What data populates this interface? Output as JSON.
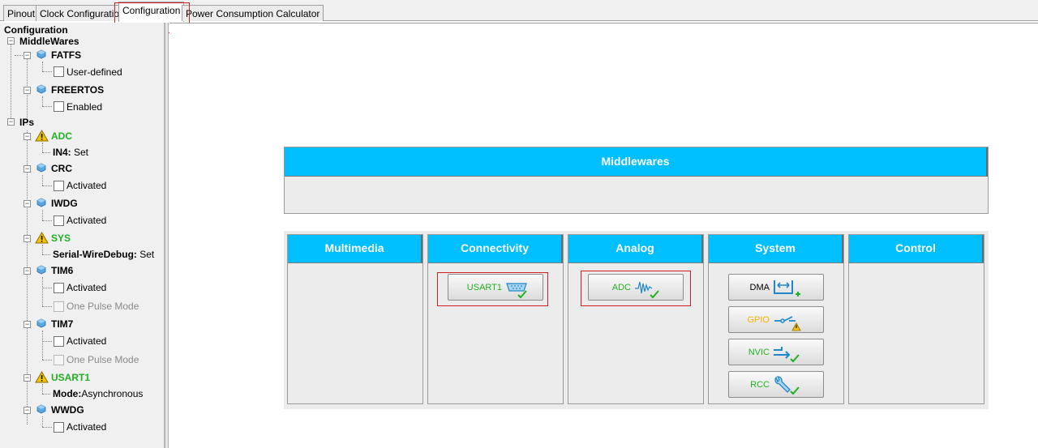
{
  "tabs": [
    {
      "label": "Pinout",
      "active": false
    },
    {
      "label": "Clock Configuration",
      "active": false
    },
    {
      "label": "Configuration",
      "active": true
    },
    {
      "label": "Power Consumption Calculator",
      "active": false
    }
  ],
  "tree": {
    "root": "Configuration",
    "middlewares": {
      "label": "MiddleWares",
      "items": [
        {
          "name": "FATFS",
          "option": "User-defined"
        },
        {
          "name": "FREERTOS",
          "option": "Enabled"
        }
      ]
    },
    "ips": {
      "label": "IPs",
      "adc": {
        "name": "ADC",
        "key": "IN4:",
        "value": " Set"
      },
      "crc": {
        "name": "CRC",
        "option": "Activated"
      },
      "iwdg": {
        "name": "IWDG",
        "option": "Activated"
      },
      "sys": {
        "name": "SYS",
        "key": "Serial-WireDebug:",
        "value": " Set"
      },
      "tim6": {
        "name": "TIM6",
        "option1": "Activated",
        "option2": "One Pulse Mode"
      },
      "tim7": {
        "name": "TIM7",
        "option1": "Activated",
        "option2": "One Pulse Mode"
      },
      "usart1": {
        "name": "USART1",
        "key": "Mode:",
        "value": "Asynchronous"
      },
      "wwdg": {
        "name": "WWDG",
        "option": "Activated"
      }
    }
  },
  "middlewares_panel": {
    "title": "Middlewares"
  },
  "categories": {
    "multimedia": {
      "title": "Multimedia"
    },
    "connectivity": {
      "title": "Connectivity",
      "buttons": [
        {
          "label": "USART1"
        }
      ]
    },
    "analog": {
      "title": "Analog",
      "buttons": [
        {
          "label": "ADC"
        }
      ]
    },
    "system": {
      "title": "System",
      "buttons": [
        {
          "label": "DMA"
        },
        {
          "label": "GPIO"
        },
        {
          "label": "NVIC"
        },
        {
          "label": "RCC"
        }
      ]
    },
    "control": {
      "title": "Control"
    }
  },
  "colors": {
    "header_blue": "#00bfff",
    "ok_green": "#22b022",
    "warn_yellow": "#f5c400",
    "highlight_red": "#d21f1f"
  },
  "icons": {
    "ip_node": "ip-cube-icon",
    "warning": "warning-icon",
    "ok": "check-icon"
  }
}
